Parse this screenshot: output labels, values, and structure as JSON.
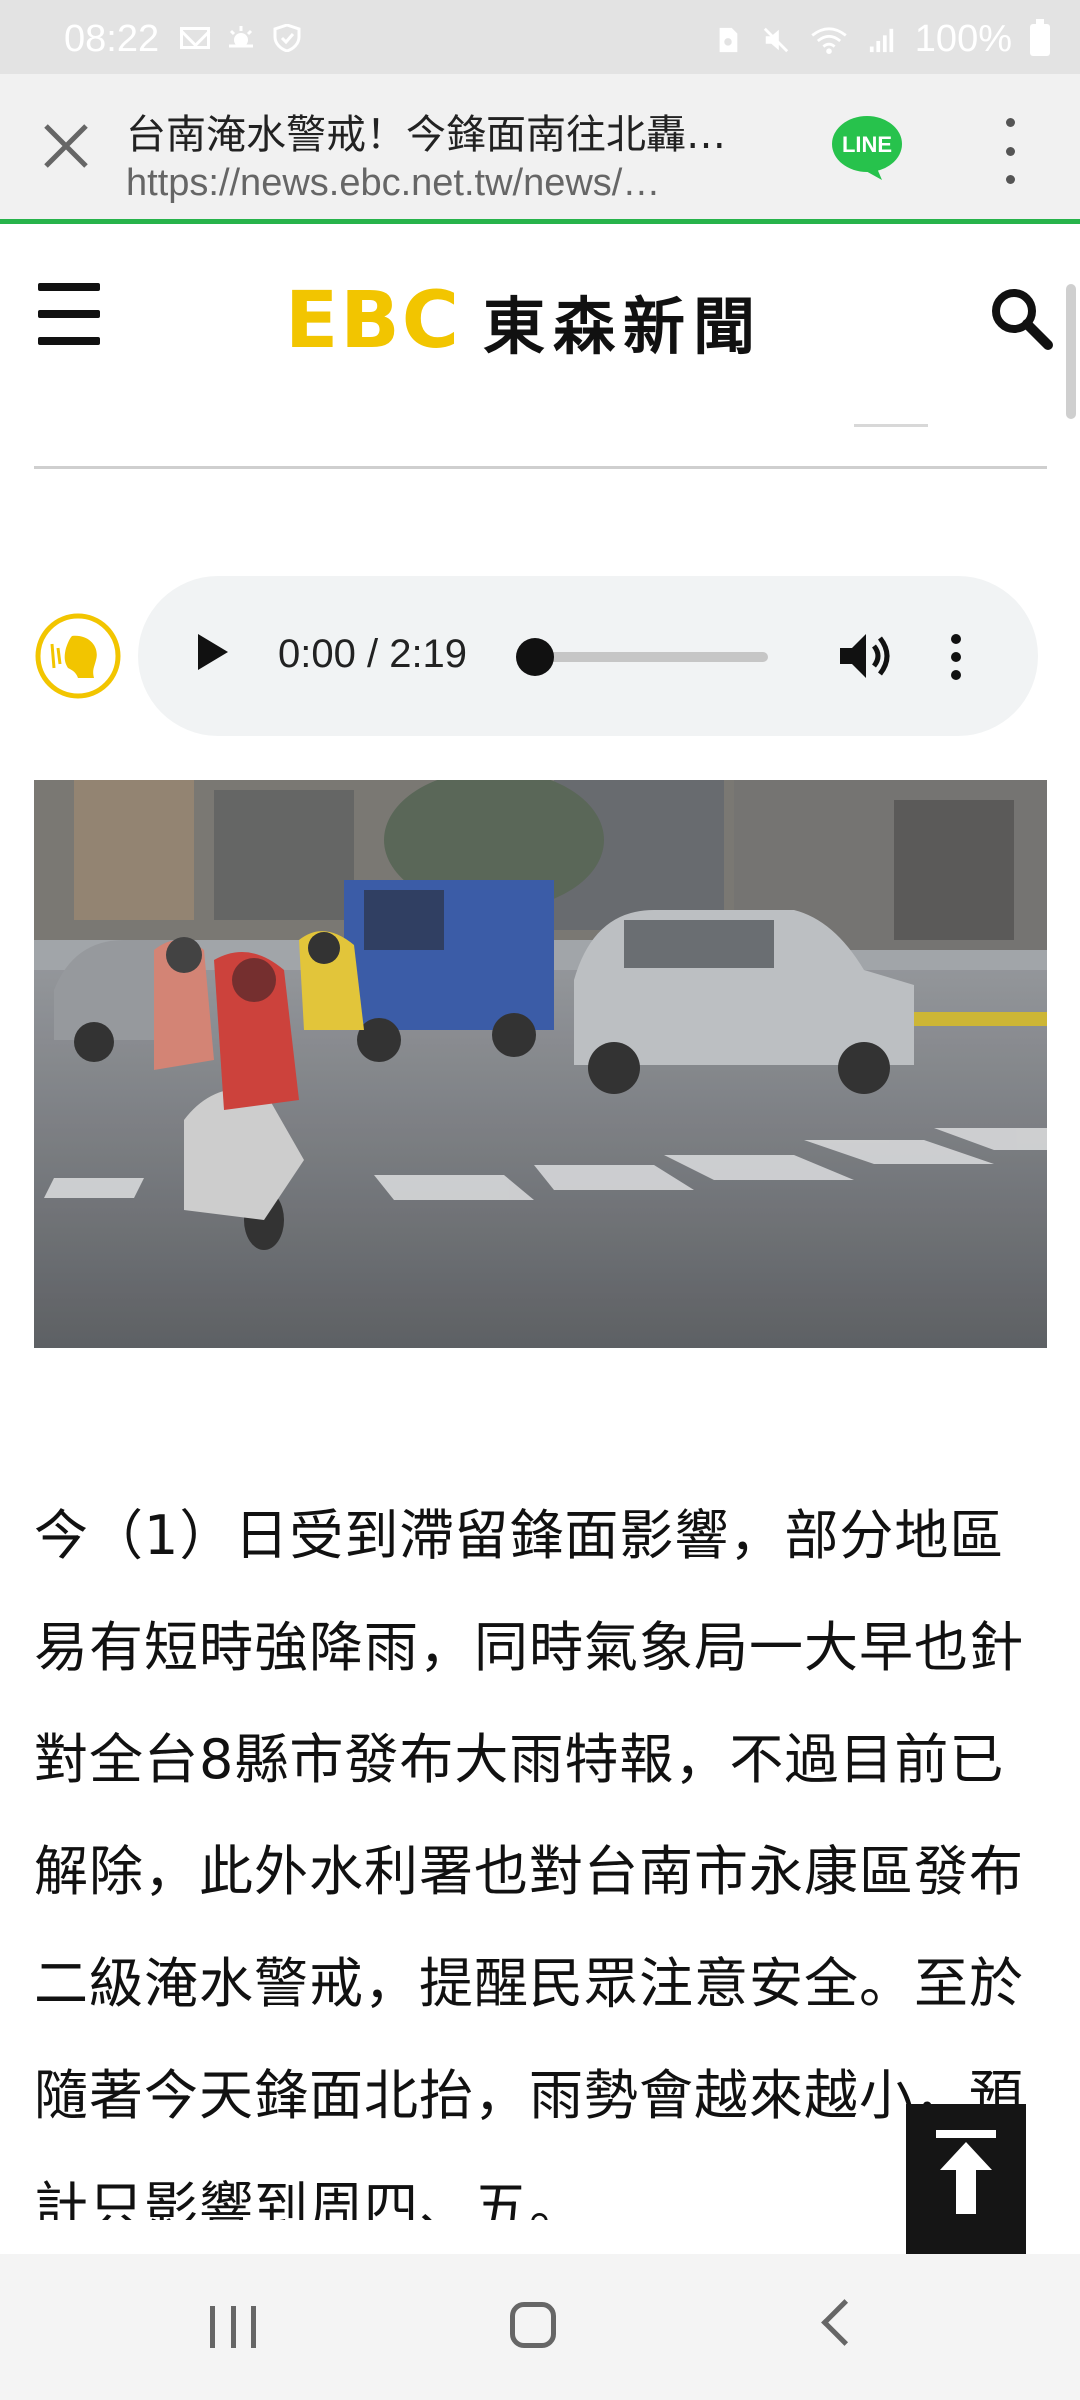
{
  "status_bar": {
    "time": "08:22",
    "battery": "100%",
    "left_icons": [
      "mail-icon",
      "weather-icon",
      "shield-icon"
    ],
    "right_icons": [
      "sim-icon",
      "mute-icon",
      "wifi-icon",
      "signal-icon",
      "battery-icon"
    ]
  },
  "browser": {
    "title": "台南淹水警戒！今鋒面南往北轟…",
    "url": "https://news.ebc.net.tw/news/…",
    "line_label": "LINE",
    "accent_color": "#27b34b"
  },
  "site": {
    "logo_ebc": "EBC",
    "logo_name": "東森新聞",
    "logo_color": "#f2c500"
  },
  "audio": {
    "time": "0:00 / 2:19",
    "progress": 0
  },
  "article": {
    "text": "今（1）日受到滯留鋒面影響，部分地區易有短時強降雨，同時氣象局一大早也針對全台8縣市發布大雨特報，不過目前已解除，此外水利署也對台南市永康區發布二級淹水警戒，提醒民眾注意安全。至於隨著今天鋒面北抬，雨勢會越來越小，預計只影響到周四、五。"
  }
}
